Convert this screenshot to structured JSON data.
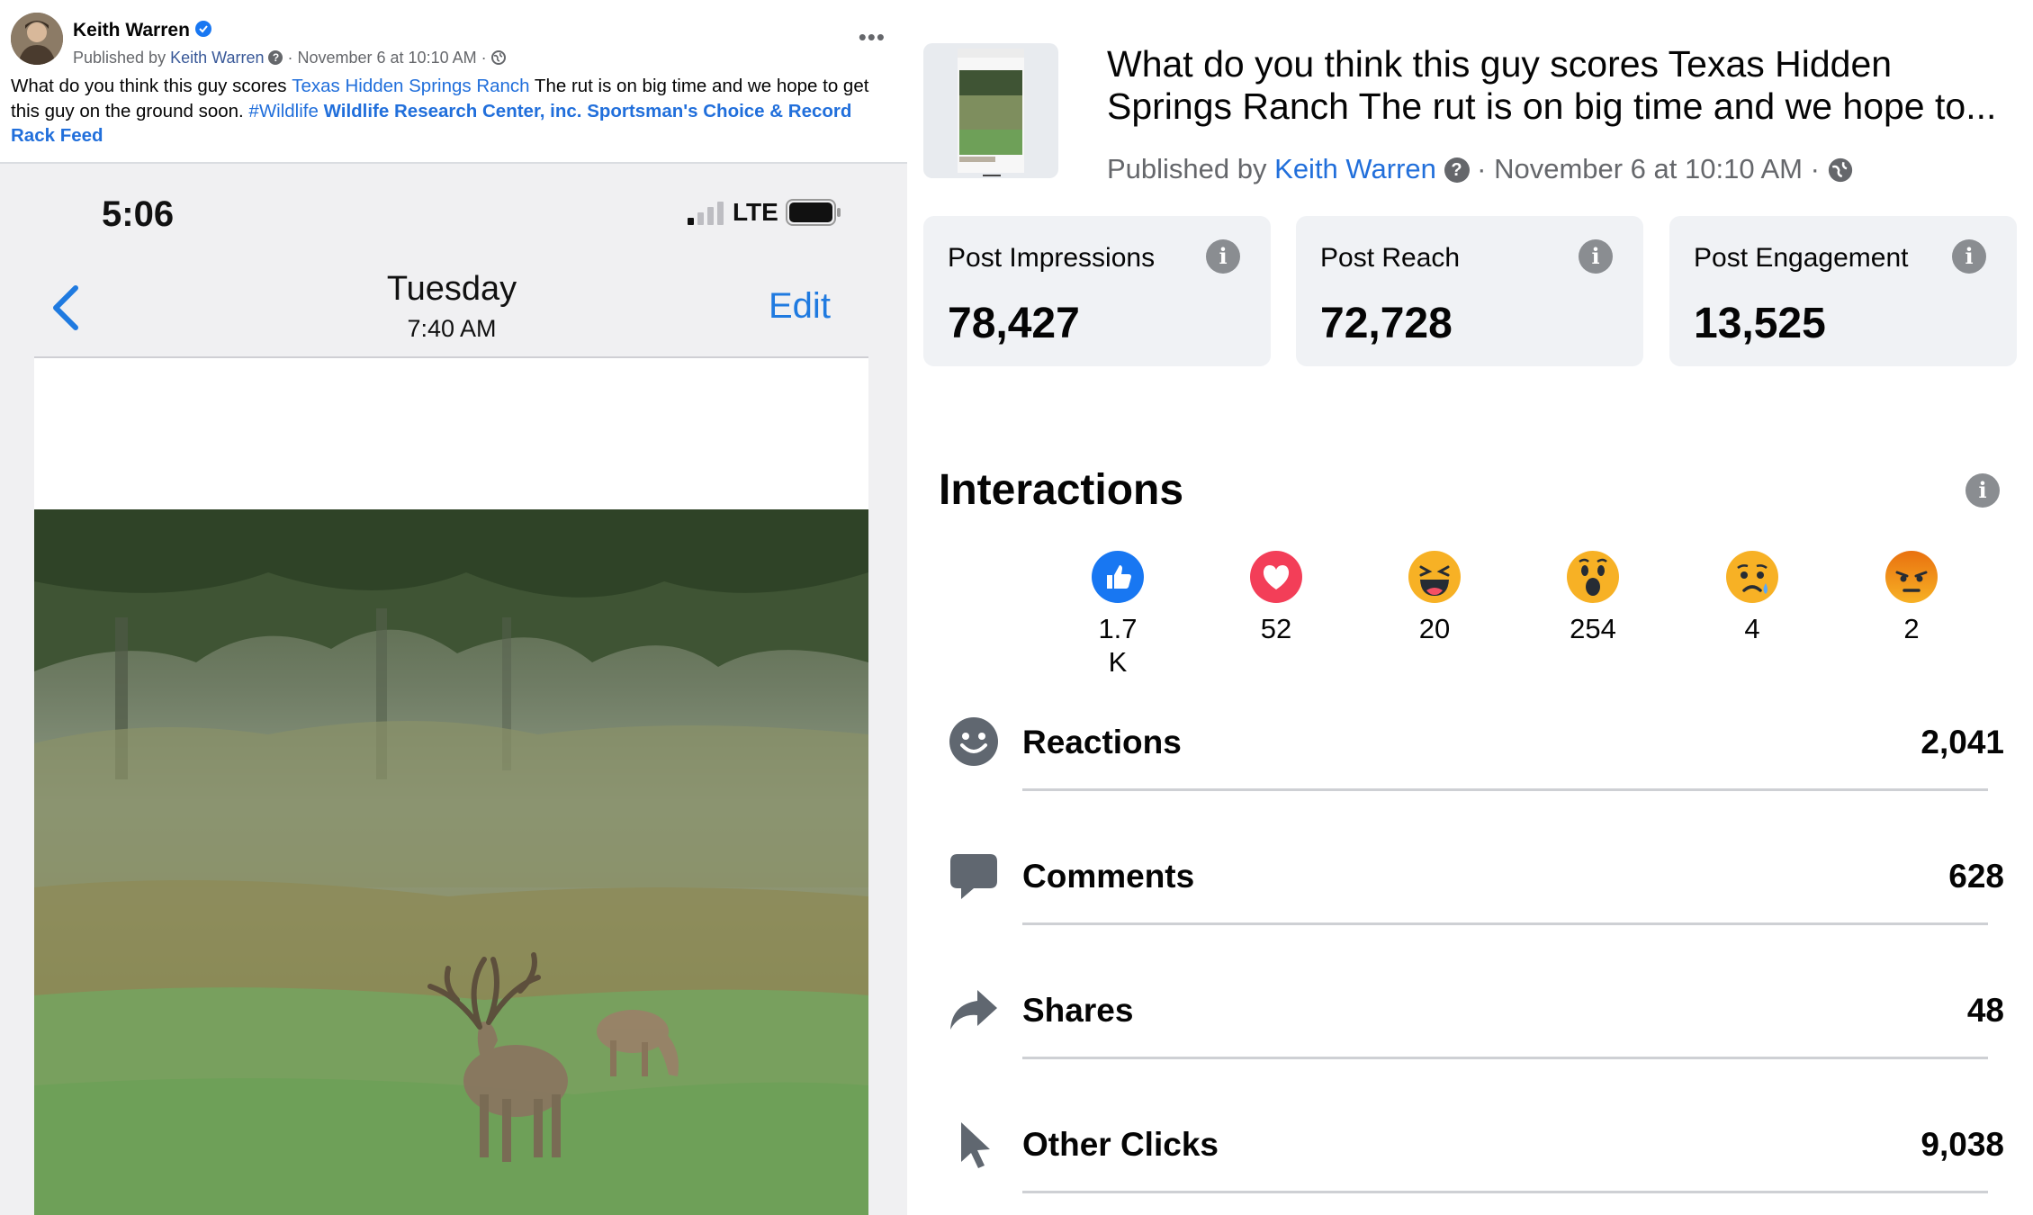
{
  "post": {
    "author": "Keith Warren",
    "meta_prefix": "Published by",
    "meta_author": "Keith Warren",
    "meta_date": "· November 6 at 10:10 AM ·",
    "caption_part1": "What do you think this guy scores ",
    "caption_link1": "Texas Hidden Springs Ranch",
    "caption_part2": " The rut is on big time and we hope to get this guy on the ground soon. ",
    "caption_hashtag": "#Wildlife",
    "caption_link2": " Wildlife Research Center, inc. Sportsman's Choice & Record Rack Feed"
  },
  "phone": {
    "time": "5:06",
    "network": "LTE",
    "nav_title": "Tuesday",
    "nav_subtitle": "7:40 AM",
    "nav_edit": "Edit"
  },
  "insights": {
    "title": "What do you think this guy scores Texas Hidden Springs Ranch The rut is on big time and we hope to...",
    "pub_prefix": "Published by",
    "pub_author": "Keith Warren",
    "pub_date": "· November 6 at 10:10 AM ·",
    "cards": [
      {
        "label": "Post Impressions",
        "value": "78,427"
      },
      {
        "label": "Post Reach",
        "value": "72,728"
      },
      {
        "label": "Post Engagement",
        "value": "13,525"
      }
    ],
    "interactions_title": "Interactions",
    "reactions": [
      {
        "icon": "like-icon",
        "count": "1.7K"
      },
      {
        "icon": "love-icon",
        "count": "52"
      },
      {
        "icon": "haha-icon",
        "count": "20"
      },
      {
        "icon": "wow-icon",
        "count": "254"
      },
      {
        "icon": "sad-icon",
        "count": "4"
      },
      {
        "icon": "angry-icon",
        "count": "2"
      }
    ],
    "metrics": [
      {
        "icon": "smiley-icon",
        "label": "Reactions",
        "value": "2,041"
      },
      {
        "icon": "comment-icon",
        "label": "Comments",
        "value": "628"
      },
      {
        "icon": "share-icon",
        "label": "Shares",
        "value": "48"
      },
      {
        "icon": "cursor-icon",
        "label": "Other Clicks",
        "value": "9,038"
      }
    ]
  },
  "colors": {
    "link": "#216fdb",
    "card_bg": "#f0f2f5",
    "like_blue": "#1877f2",
    "love_red": "#f33e58",
    "emoji_yellow": "#f7b125",
    "angry_orange": "#e9710f"
  }
}
